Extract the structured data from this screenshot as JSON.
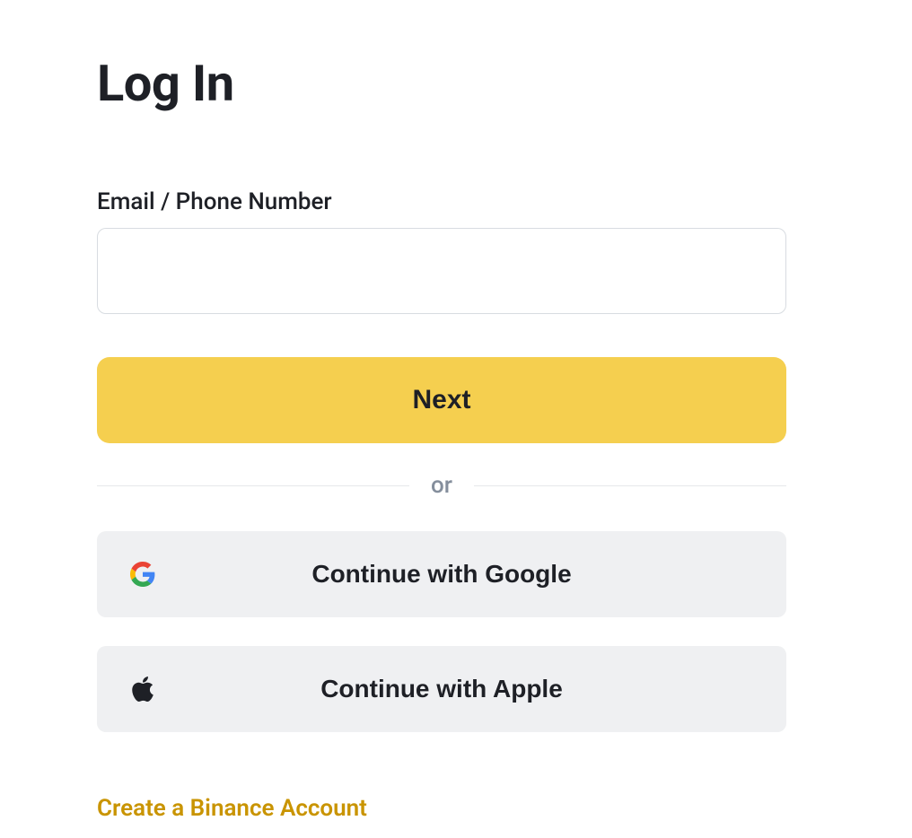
{
  "title": "Log In",
  "form": {
    "email_label": "Email / Phone Number",
    "email_value": "",
    "next_button": "Next"
  },
  "divider_text": "or",
  "social": {
    "google_label": "Continue with Google",
    "apple_label": "Continue with Apple"
  },
  "create_account_link": "Create a Binance Account"
}
